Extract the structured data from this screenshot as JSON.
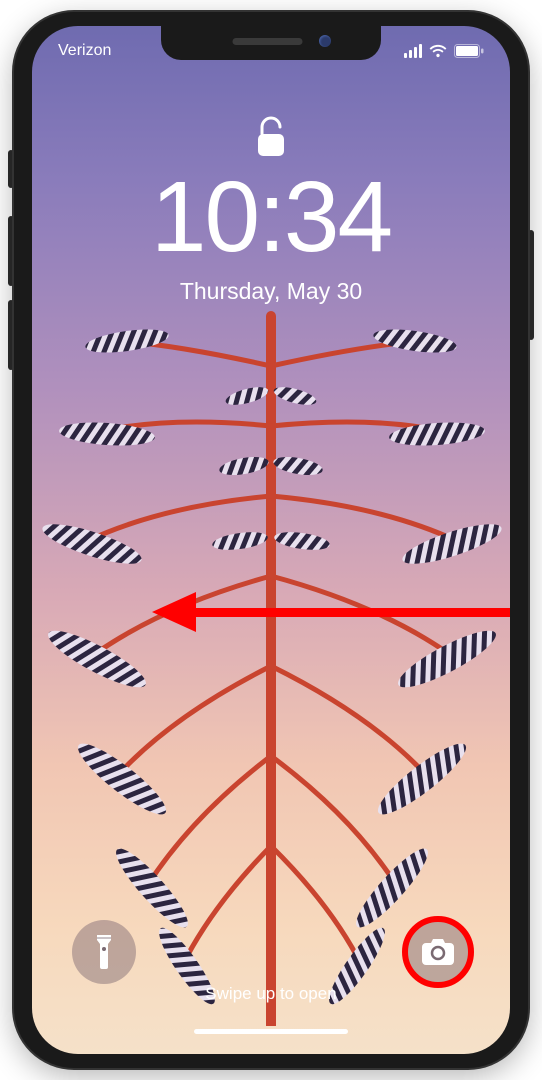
{
  "status": {
    "carrier": "Verizon"
  },
  "lockscreen": {
    "time": "10:34",
    "date": "Thursday, May 30",
    "swipe_hint": "Swipe up to open"
  }
}
